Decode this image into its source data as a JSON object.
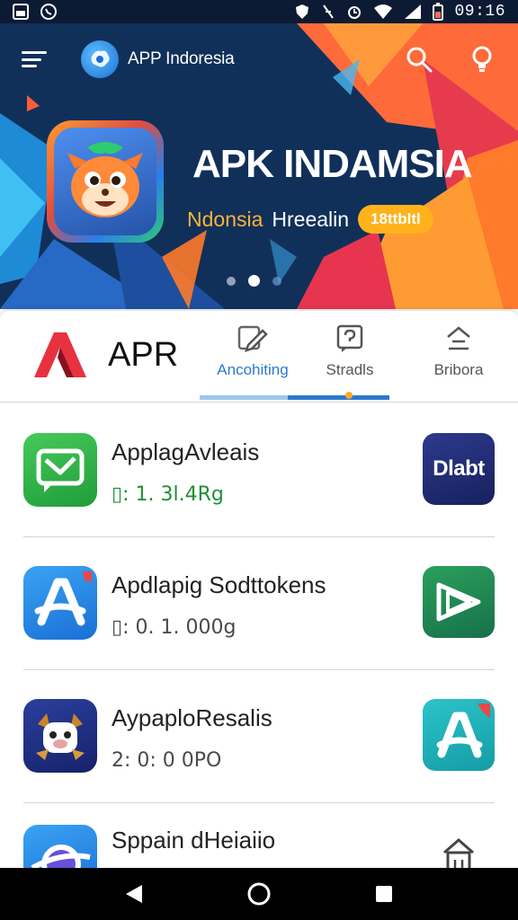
{
  "status_bar": {
    "time": "09:16",
    "icons": [
      "gallery-icon",
      "whatsapp-icon",
      "shield-icon",
      "vibrate-icon",
      "alarm-icon",
      "wifi-icon",
      "signal-icon",
      "battery-icon"
    ]
  },
  "header": {
    "brand": "APP Indoresia",
    "menu_icon": "hamburger-menu-icon",
    "search_icon": "search-icon",
    "bulb_icon": "lightbulb-icon"
  },
  "banner": {
    "title": "APK INDAMSIA",
    "subtitle_highlight": "Ndonsia",
    "subtitle_rest": "Hreealin",
    "badge": "18ttbltl",
    "slides": 3,
    "active_slide": 2
  },
  "tabs": {
    "logo_text": "APR",
    "items": [
      {
        "label": "Ancohiting",
        "icon": "edit-icon",
        "active": true
      },
      {
        "label": "Stradls",
        "icon": "message-icon",
        "active": false
      },
      {
        "label": "Bribora",
        "icon": "home-up-icon",
        "active": false
      }
    ]
  },
  "apps": [
    {
      "name": "ApplagAvleais",
      "meta": "▯: 1. 3l.4Rg",
      "icon": "message-envelope-icon",
      "action_icon": "dlabt-badge-icon",
      "action_text": "Dlabt"
    },
    {
      "name": "Apdlapig Sodttokens",
      "meta": "▯: 0. 1. 000g",
      "icon": "app-store-a-icon",
      "action_icon": "play-arrow-icon",
      "action_text": ""
    },
    {
      "name": "AypaploResalis",
      "meta": "2: 0: 0 0PO",
      "icon": "cartoon-dog-icon",
      "action_icon": "app-store-a-icon",
      "action_text": ""
    },
    {
      "name": "Sppain dHeiaiio",
      "meta": "",
      "icon": "globe-swoosh-icon",
      "action_icon": "house-icon",
      "action_text": ""
    }
  ],
  "colors": {
    "accent": "#2a7ad0",
    "banner_bg": "#0f2c52",
    "badge": "#ffb21c",
    "orange": "#ff7a2e"
  },
  "nav": {
    "back_icon": "back-icon",
    "home_icon": "home-circle-icon",
    "recents_icon": "recents-square-icon"
  }
}
